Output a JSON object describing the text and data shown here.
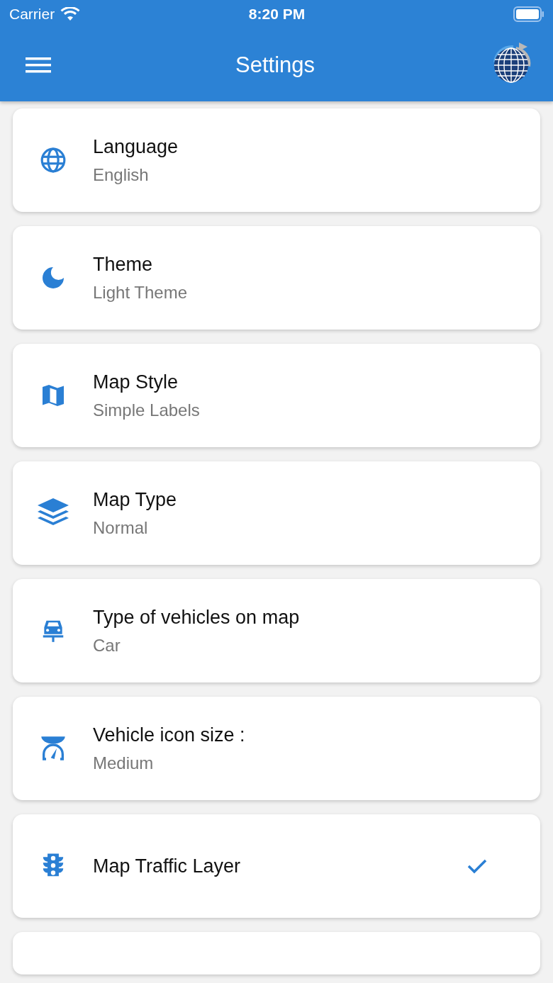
{
  "status_bar": {
    "carrier": "Carrier",
    "time": "8:20 PM"
  },
  "app_bar": {
    "title": "Settings"
  },
  "settings": [
    {
      "kind": "value",
      "title": "Language",
      "value": "English"
    },
    {
      "kind": "value",
      "title": "Theme",
      "value": "Light Theme"
    },
    {
      "kind": "value",
      "title": "Map Style",
      "value": "Simple Labels"
    },
    {
      "kind": "value",
      "title": "Map Type",
      "value": "Normal"
    },
    {
      "kind": "value",
      "title": "Type of vehicles on map",
      "value": "Car"
    },
    {
      "kind": "value",
      "title": "Vehicle icon size :",
      "value": "Medium"
    },
    {
      "kind": "toggle",
      "title": "Map Traffic Layer",
      "checked": true
    },
    {
      "kind": "empty"
    }
  ]
}
